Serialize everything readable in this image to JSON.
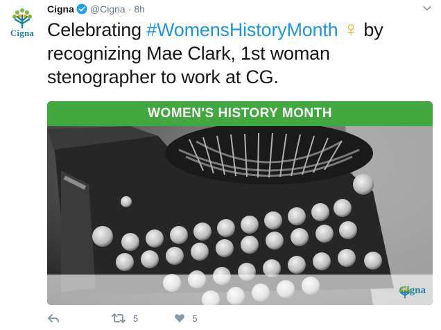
{
  "tweet": {
    "display_name": "Cigna",
    "handle": "@Cigna",
    "separator": "·",
    "time": "8h",
    "text_before": "Celebrating ",
    "hashtag": "#WomensHistoryMonth",
    "female_symbol": "♀",
    "text_after": " by recognizing Mae Clark, 1st woman stenographer to work at CG."
  },
  "avatar": {
    "wordmark": "Cigna"
  },
  "media": {
    "banner_text": "WOMEN'S HISTORY MONTH",
    "logo_text": "Cigna",
    "banner_color": "#40a83e"
  },
  "actions": {
    "retweet_count": "5",
    "like_count": "5"
  },
  "icons": [
    "verified-badge-icon",
    "chevron-down-icon",
    "reply-icon",
    "retweet-icon",
    "heart-icon",
    "cigna-tree-icon"
  ],
  "colors": {
    "link": "#1b95e0",
    "brand_green": "#40a83e",
    "brand_blue": "#1f7ea8",
    "muted": "#657786"
  }
}
